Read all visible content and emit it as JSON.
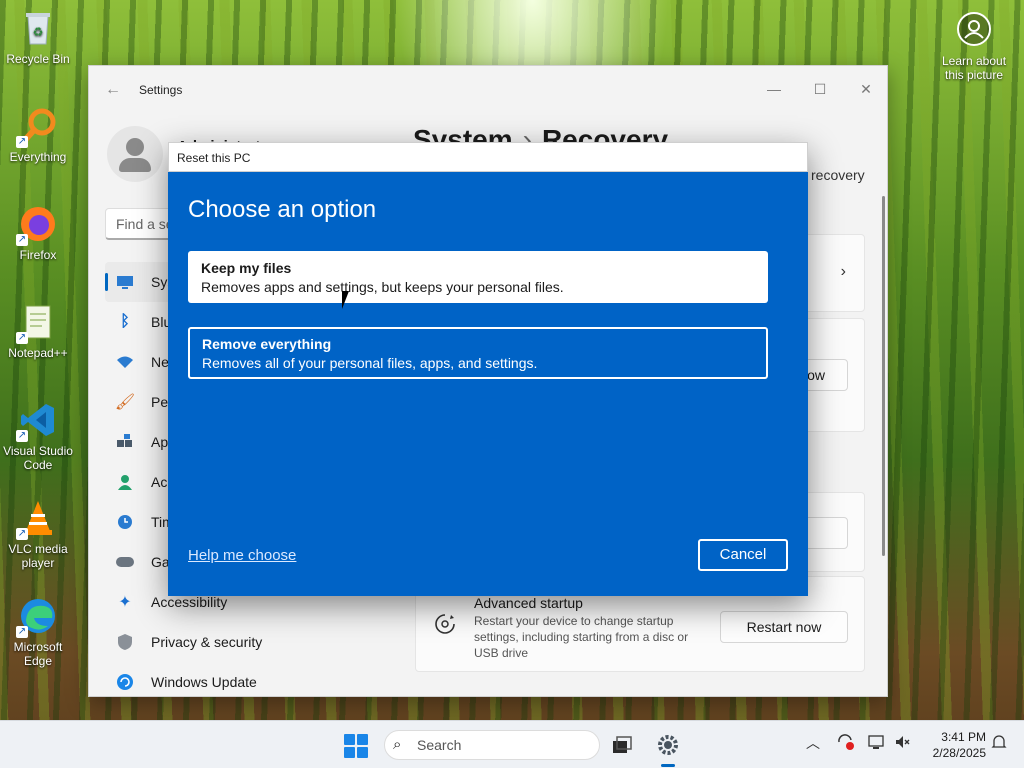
{
  "desktop": {
    "icons": [
      {
        "label": "Recycle Bin",
        "icon": "recycle-bin-icon"
      },
      {
        "label": "Everything",
        "icon": "magnifier-icon"
      },
      {
        "label": "Firefox",
        "icon": "firefox-icon"
      },
      {
        "label": "Notepad++",
        "icon": "notepad-icon"
      },
      {
        "label": "Visual Studio Code",
        "icon": "vscode-icon"
      },
      {
        "label": "VLC media player",
        "icon": "vlc-icon"
      },
      {
        "label": "Microsoft Edge",
        "icon": "edge-icon"
      }
    ],
    "learn_about": "Learn about this picture"
  },
  "settings": {
    "title": "Settings",
    "search_placeholder": "Find a se",
    "breadcrumb": {
      "parent": "System",
      "separator": "›",
      "current": "Recovery"
    },
    "account_partial": "Administrator",
    "related_partial": "recovery",
    "nav": [
      {
        "label": "System",
        "partial": "Sys",
        "icon": "monitor-icon",
        "active": true
      },
      {
        "label": "Bluetooth & devices",
        "partial": "Blu",
        "icon": "bluetooth-icon"
      },
      {
        "label": "Network & internet",
        "partial": "Net",
        "icon": "wifi-icon"
      },
      {
        "label": "Personalization",
        "partial": "Per",
        "icon": "brush-icon"
      },
      {
        "label": "Apps",
        "partial": "App",
        "icon": "apps-icon"
      },
      {
        "label": "Accounts",
        "partial": "Acc",
        "icon": "person-icon"
      },
      {
        "label": "Time & language",
        "partial": "Tim",
        "icon": "clock-icon"
      },
      {
        "label": "Gaming",
        "partial": "Gan",
        "icon": "gamepad-icon"
      },
      {
        "label": "Accessibility",
        "partial": "Accessibility",
        "icon": "accessibility-icon"
      },
      {
        "label": "Privacy & security",
        "partial": "Privacy & security",
        "icon": "shield-icon"
      },
      {
        "label": "Windows Update",
        "partial": "Windows Update",
        "icon": "update-icon"
      }
    ],
    "reset_button_partial": "ow",
    "advanced_startup": {
      "title": "Advanced startup",
      "description": "Restart your device to change startup settings, including starting from a disc or USB drive",
      "button": "Restart now"
    }
  },
  "dialog": {
    "window_title": "Reset this PC",
    "heading": "Choose an option",
    "options": [
      {
        "title": "Keep my files",
        "description": "Removes apps and settings, but keeps your personal files."
      },
      {
        "title": "Remove everything",
        "description": "Removes all of your personal files, apps, and settings."
      }
    ],
    "help_link": "Help me choose",
    "cancel": "Cancel"
  },
  "taskbar": {
    "search_placeholder": "Search",
    "time": "3:41 PM",
    "date": "2/28/2025"
  },
  "colors": {
    "dialog_blue": "#0063c6",
    "accent": "#0067c0"
  }
}
